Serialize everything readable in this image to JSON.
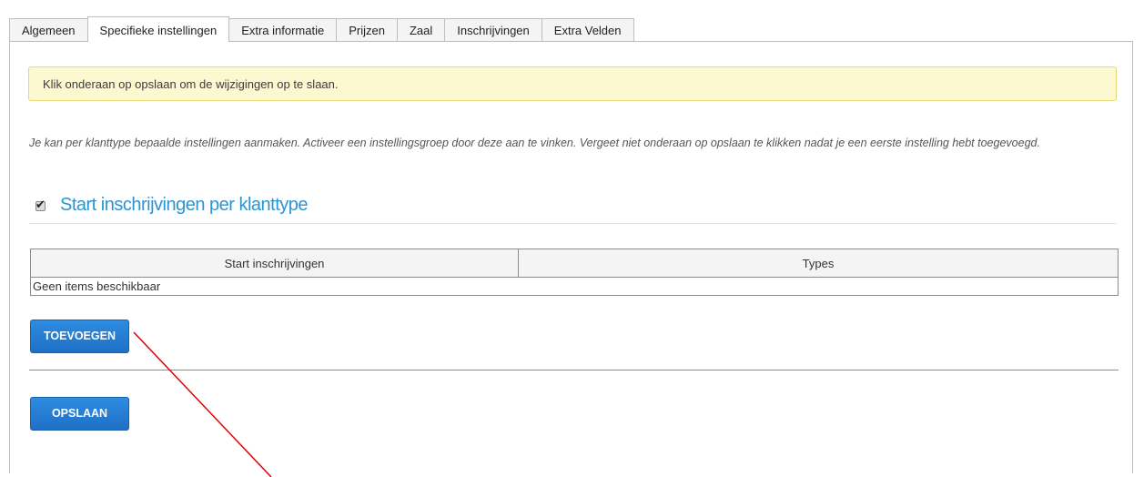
{
  "tabs": [
    {
      "label": "Algemeen"
    },
    {
      "label": "Specifieke instellingen",
      "active": true
    },
    {
      "label": "Extra informatie"
    },
    {
      "label": "Prijzen"
    },
    {
      "label": "Zaal"
    },
    {
      "label": "Inschrijvingen"
    },
    {
      "label": "Extra Velden"
    }
  ],
  "notice": "Klik onderaan op opslaan om de wijzigingen op te slaan.",
  "help_text": "Je kan per klanttype bepaalde instellingen aanmaken. Activeer een instellingsgroep door deze aan te vinken. Vergeet niet onderaan op opslaan te klikken nadat je een eerste instelling hebt toegevoegd.",
  "section": {
    "title": "Start inschrijvingen per klanttype",
    "checked": true
  },
  "table": {
    "columns": [
      "Start inschrijvingen",
      "Types"
    ],
    "empty_message": "Geen items beschikbaar"
  },
  "buttons": {
    "add": "TOEVOEGEN",
    "save": "OPSLAAN"
  },
  "colors": {
    "accent": "#2a94d4",
    "button": "#1f6fc6",
    "notice_bg": "#fcf8cf",
    "arrow": "#e00000"
  }
}
